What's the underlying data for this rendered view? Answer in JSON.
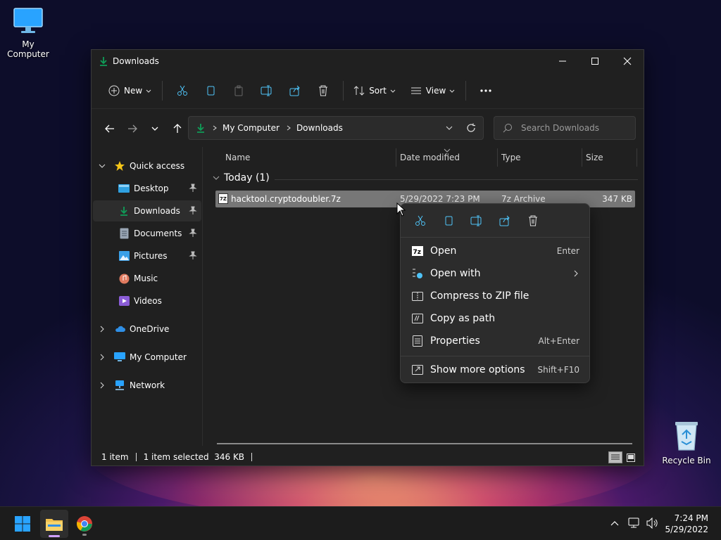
{
  "desktop": {
    "icons": [
      {
        "label": "My Computer"
      },
      {
        "label": "Recycle Bin"
      }
    ]
  },
  "window": {
    "title": "Downloads",
    "toolbar": {
      "new_label": "New",
      "sort_label": "Sort",
      "view_label": "View"
    },
    "address": {
      "crumbs": [
        "My Computer",
        "Downloads"
      ],
      "search_placeholder": "Search Downloads"
    },
    "sidebar": {
      "quick_access": "Quick access",
      "items": [
        {
          "label": "Desktop",
          "pinned": true
        },
        {
          "label": "Downloads",
          "pinned": true
        },
        {
          "label": "Documents",
          "pinned": true
        },
        {
          "label": "Pictures",
          "pinned": true
        },
        {
          "label": "Music",
          "pinned": false
        },
        {
          "label": "Videos",
          "pinned": false
        }
      ],
      "roots": [
        "OneDrive",
        "My Computer",
        "Network"
      ]
    },
    "columns": [
      "Name",
      "Date modified",
      "Type",
      "Size"
    ],
    "group": "Today (1)",
    "files": [
      {
        "name": "hacktool.cryptodoubler.7z",
        "date": "5/29/2022 7:23 PM",
        "type": "7z Archive",
        "size": "347 KB"
      }
    ],
    "status": {
      "count": "1 item",
      "selected": "1 item selected  346 KB"
    }
  },
  "context_menu": {
    "items": [
      {
        "label": "Open",
        "shortcut": "Enter"
      },
      {
        "label": "Open with",
        "shortcut": ""
      },
      {
        "label": "Compress to ZIP file",
        "shortcut": ""
      },
      {
        "label": "Copy as path",
        "shortcut": ""
      },
      {
        "label": "Properties",
        "shortcut": "Alt+Enter"
      },
      {
        "label": "Show more options",
        "shortcut": "Shift+F10"
      }
    ]
  },
  "taskbar": {
    "time": "7:24 PM",
    "date": "5/29/2022"
  },
  "colors": {
    "accent": "#0f9d58",
    "folder": "#f2c14e",
    "windows_blue": "#29a3ff"
  }
}
